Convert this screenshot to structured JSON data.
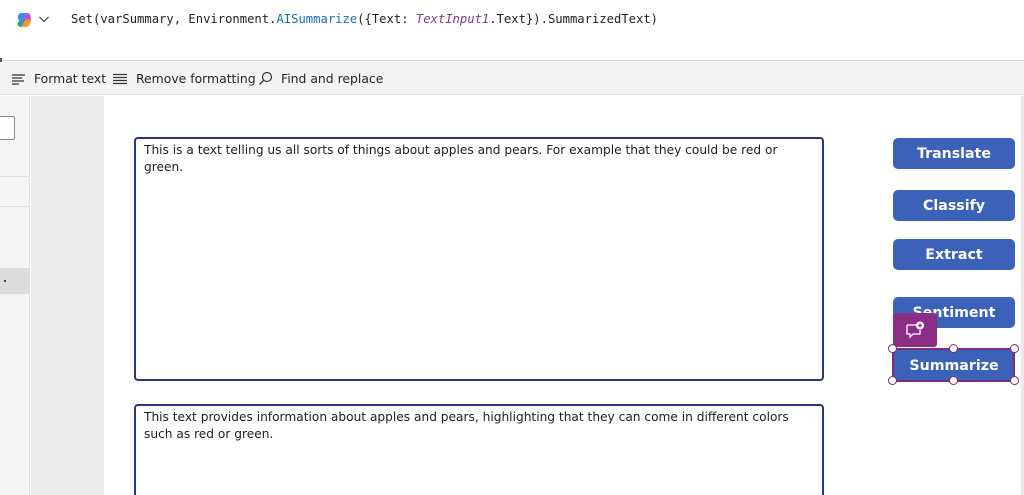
{
  "formula": {
    "part1": "Set(varSummary, Environment.",
    "fn": "AISummarize",
    "part2": "({Text: ",
    "param": "TextInput1",
    "part3": ".Text}).SummarizedText)"
  },
  "toolbar": {
    "format_text": "Format text",
    "remove_formatting": "Remove formatting",
    "find_replace": "Find and replace"
  },
  "textboxes": {
    "input_text": "This is a text telling us all sorts of things about apples and pears. For example that they could be red or green.",
    "summary_text": "This text provides information about apples and pears, highlighting that they can come in different colors such as red or green."
  },
  "buttons": {
    "translate": "Translate",
    "classify": "Classify",
    "extract": "Extract",
    "sentiment": "Sentiment",
    "summarize": "Summarize"
  },
  "icons": {
    "copilot": "copilot-icon",
    "chevron": "chevron-down-icon",
    "format": "format-text-icon",
    "remove": "remove-formatting-icon",
    "find": "search-icon",
    "comment": "comment-add-icon"
  },
  "colors": {
    "button": "#3b62b8",
    "selection": "#7b2f78",
    "comment_badge": "#8c2e86",
    "textbox_border": "#2d3380"
  }
}
